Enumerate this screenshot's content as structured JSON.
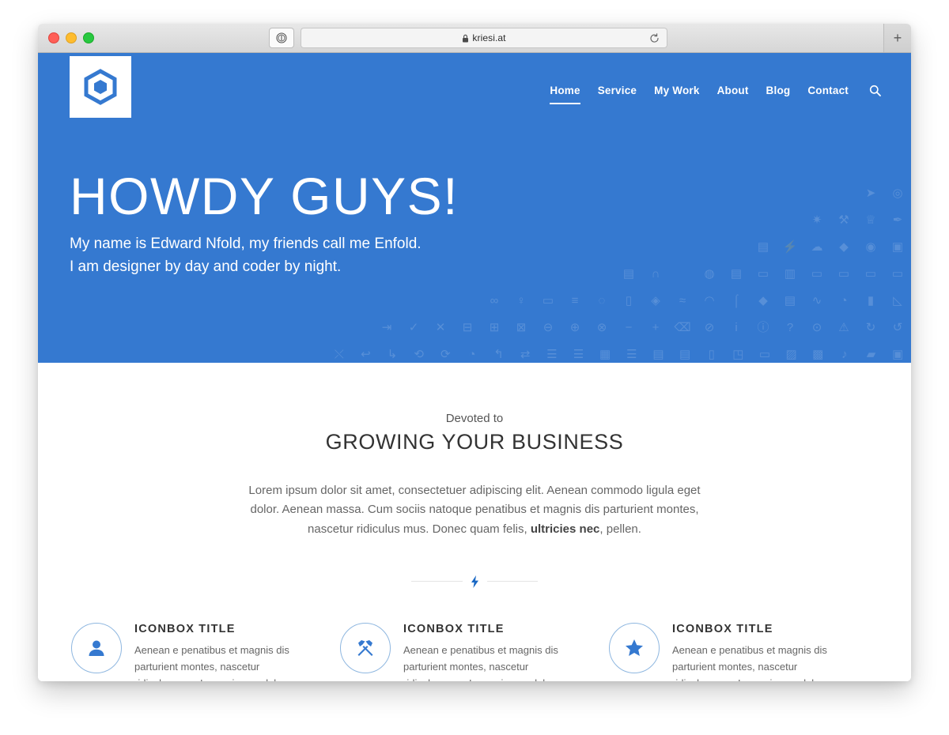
{
  "browser": {
    "traffic_lights": [
      "close",
      "minimize",
      "maximize"
    ],
    "reader_icon": "reader-view-icon",
    "lock_icon": "lock-icon",
    "url": "kriesi.at",
    "reload_icon": "reload-icon",
    "new_tab_label": "+"
  },
  "site": {
    "logo_icon": "hexagon-logo-icon",
    "nav": [
      {
        "label": "Home",
        "active": true
      },
      {
        "label": "Service",
        "active": false
      },
      {
        "label": "My Work",
        "active": false
      },
      {
        "label": "About",
        "active": false
      },
      {
        "label": "Blog",
        "active": false
      },
      {
        "label": "Contact",
        "active": false
      }
    ],
    "search_icon": "search-icon"
  },
  "hero": {
    "title": "HOWDY GUYS!",
    "subtitle_line1": "My name is Edward Nfold, my friends call me Enfold.",
    "subtitle_line2": "I am designer by day and coder by night.",
    "background_color": "#3579d0",
    "text_color": "#ffffff",
    "decorative_icons": [
      [
        "",
        "",
        "",
        "",
        "",
        "",
        "",
        "",
        "",
        "",
        "",
        "navigation-arrow-icon",
        "target-icon"
      ],
      [
        "",
        "",
        "",
        "",
        "",
        "",
        "",
        "",
        "",
        "gear-icon",
        "tools-icon",
        "trophy-icon",
        "rocket-icon"
      ],
      [
        "",
        "",
        "",
        "",
        "",
        "",
        "",
        "calendar-icon",
        "bolt-icon",
        "cloud-download-icon",
        "droplet-icon",
        "disc-icon",
        "briefcase-icon"
      ],
      [
        "",
        "",
        "",
        "",
        "money-icon",
        "headphones-icon",
        "",
        "globe-icon",
        "keyboard-icon",
        "window-icon",
        "upload-window-icon",
        "password-field-icon",
        "toolbar-icon",
        "slider-icon",
        "bar-icon"
      ],
      [
        "",
        "",
        "infinity-icon",
        "lightbulb-icon",
        "credit-card-icon",
        "database-icon",
        "voicemail-icon",
        "trash-icon",
        "tag-icon",
        "rss-icon",
        "wifi-icon",
        "thermometer-icon",
        "humidity-icon",
        "layout-icon",
        "line-chart-icon",
        "pie-chart-icon",
        "bar-chart-icon",
        "area-chart-icon"
      ],
      [
        "login-icon",
        "check-icon",
        "close-x-icon",
        "minus-box-icon",
        "plus-box-icon",
        "x-box-icon",
        "minus-circle-icon",
        "plus-circle-icon",
        "x-circle-icon",
        "minus-icon",
        "plus-icon",
        "backspace-icon",
        "ban-icon",
        "info-i-icon",
        "info-circle-icon",
        "question-icon",
        "question-circle-icon",
        "warning-icon",
        "refresh-icon",
        "reload-circle-icon"
      ],
      [
        "shuffle-icon",
        "undo-icon",
        "redo-icon",
        "repeat-icon",
        "loop-icon",
        "history-icon",
        "return-icon",
        "swap-icon",
        "list-icon",
        "list-add-icon",
        "grid-icon",
        "menu-icon",
        "document-icon",
        "book-icon",
        "mobile-icon",
        "layers-icon",
        "window-frame-icon",
        "archive-icon",
        "film-icon",
        "music-icon",
        "folder-icon",
        "toolbox-icon"
      ]
    ]
  },
  "section": {
    "eyebrow": "Devoted to",
    "title": "GROWING YOUR BUSINESS",
    "body_part1": "Lorem ipsum dolor sit amet, consectetuer adipiscing elit. Aenean commodo ligula eget dolor. Aenean massa. Cum sociis natoque penatibus et magnis dis parturient montes, nascetur ridiculus mus. Donec quam felis, ",
    "body_bold": "ultricies nec",
    "body_part2": ", pellen.",
    "divider_icon": "bolt-icon"
  },
  "iconboxes": [
    {
      "icon": "user-icon",
      "title": "ICONBOX TITLE",
      "description": "Aenean e penatibus et magnis dis parturient montes, nascetur ridiculus mus. Lorem ipsum dolor sit amet, consectetuer adipiscing elit."
    },
    {
      "icon": "tools-icon",
      "title": "ICONBOX TITLE",
      "description": "Aenean e penatibus et magnis dis parturient montes, nascetur ridiculus mus. Lorem ipsum dolor sit amet, consectetuer adipiscing elit."
    },
    {
      "icon": "star-icon",
      "title": "ICONBOX TITLE",
      "description": "Aenean e penatibus et magnis dis parturient montes, nascetur ridiculus mus. Lorem ipsum dolor sit amet, consectetuer adipiscing elit."
    }
  ],
  "colors": {
    "brand_blue": "#3579d0",
    "accent_blue": "#1a68c4",
    "circle_border": "#8fb7e0",
    "heading": "#333333",
    "body_text": "#666666"
  }
}
